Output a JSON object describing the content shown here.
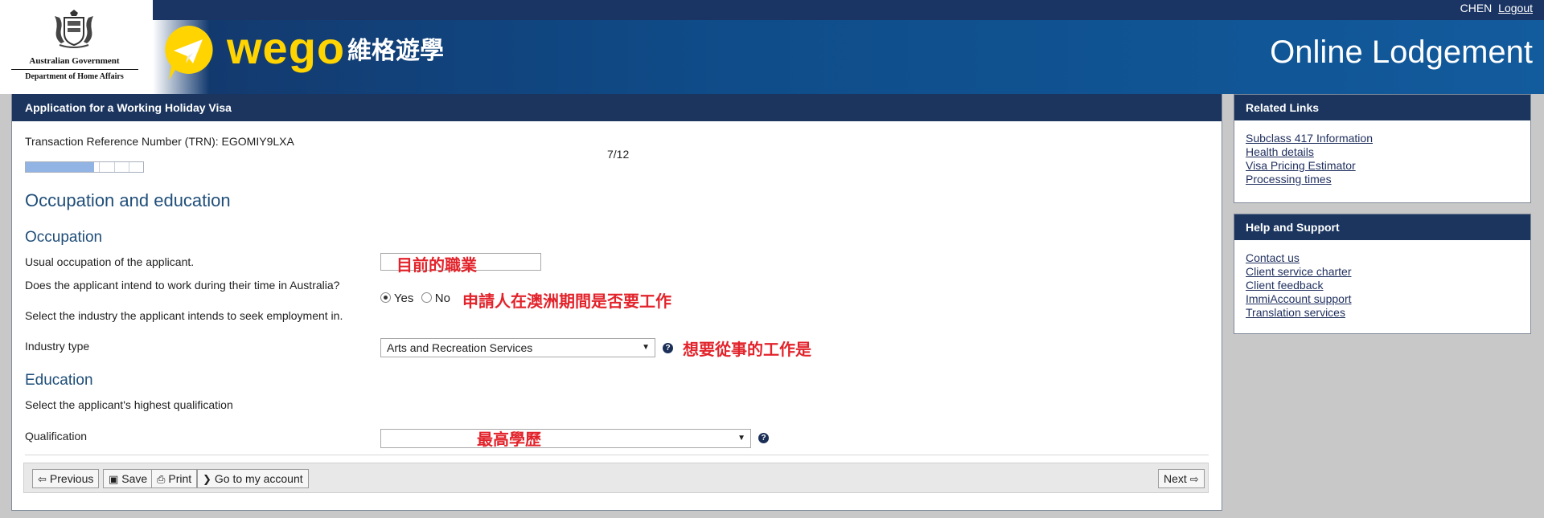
{
  "header": {
    "gov_line1": "Australian Government",
    "gov_line2": "Department of Home Affairs",
    "brand_name": "wego",
    "brand_cn": "維格遊學",
    "title": "Online Lodgement",
    "user_name": "CHEN",
    "logout_label": "Logout"
  },
  "main": {
    "panel_title": "Application for a Working Holiday Visa",
    "trn_text": "Transaction Reference Number (TRN): EGOMIY9LXA",
    "step_label": "7/12",
    "progress_fraction": 0.583,
    "progress_segments": 5,
    "section_title": "Occupation and education",
    "occupation": {
      "title": "Occupation",
      "usual_label": "Usual occupation of the applicant.",
      "usual_value": "",
      "usual_note": "目前的職業",
      "work_question": "Does the applicant intend to work during their time in Australia?",
      "yes_label": "Yes",
      "no_label": "No",
      "selected": "Yes",
      "work_note": "申請人在澳洲期間是否要工作",
      "industry_prompt": "Select the industry the applicant intends to seek employment in.",
      "industry_label": "Industry type",
      "industry_value": "Arts and Recreation Services",
      "industry_note": "想要從事的工作是"
    },
    "education": {
      "title": "Education",
      "prompt": "Select the applicant's highest qualification",
      "qualification_label": "Qualification",
      "qualification_value": "",
      "qualification_note": "最高學歷"
    },
    "toolbar": {
      "previous": "Previous",
      "save": "Save",
      "print": "Print",
      "account": "Go to my account",
      "next": "Next"
    }
  },
  "related_links": {
    "title": "Related Links",
    "items": [
      "Subclass 417 Information",
      "Health details",
      "Visa Pricing Estimator",
      "Processing times"
    ]
  },
  "help_support": {
    "title": "Help and Support",
    "items": [
      "Contact us",
      "Client service charter",
      "Client feedback",
      "ImmiAccount support",
      "Translation services"
    ]
  },
  "colors": {
    "panel_header": "#1b355f",
    "accent_text": "#1f4e79",
    "brand_yellow": "#ffd400",
    "annotation_red": "#e2232b",
    "progress_fill": "#92b4e4"
  },
  "icons": {
    "previous": "arrow-left-icon",
    "save": "floppy-disk-icon",
    "print": "printer-icon",
    "account": "chevron-right-icon",
    "next": "arrow-right-icon",
    "help": "question-circle-icon"
  }
}
